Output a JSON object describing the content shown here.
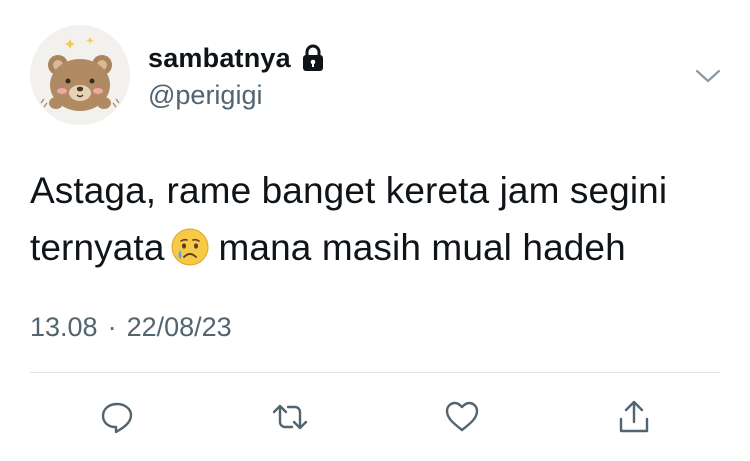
{
  "tweet": {
    "author": {
      "display_name": "sambatnya",
      "handle": "@perigigi",
      "protected_icon": "lock-icon",
      "avatar_icon": "teddy-bear-avatar"
    },
    "menu_icon": "chevron-down-icon",
    "text_line1": "Astaga, rame banget kereta jam segini",
    "text_line2_before": "ternyata",
    "text_emoji": "crying-face-emoji",
    "text_line2_after": "mana masih mual hadeh",
    "time": "13.08",
    "separator": "·",
    "date": "22/08/23"
  },
  "actions": [
    {
      "name": "reply",
      "icon": "reply-icon"
    },
    {
      "name": "retweet",
      "icon": "retweet-icon"
    },
    {
      "name": "like",
      "icon": "heart-icon"
    },
    {
      "name": "share",
      "icon": "share-icon"
    }
  ],
  "colors": {
    "text_primary": "#0f1419",
    "text_secondary": "#536471",
    "icon": "#536471",
    "divider": "#dfe3e6"
  }
}
